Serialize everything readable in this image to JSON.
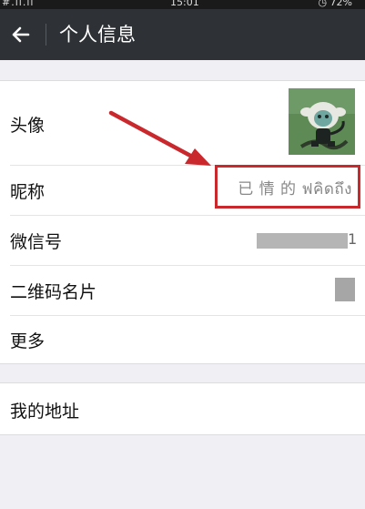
{
  "status_bar": {
    "signal": "#.ıl.ıl",
    "time": "15:01",
    "battery": "72%"
  },
  "header": {
    "title": "个人信息"
  },
  "profile": {
    "avatar_label": "头像",
    "nickname_label": "昵称",
    "nickname_value": "已 情 的 ฟคิดถึง",
    "wechat_id_label": "微信号",
    "wechat_id_suffix": "1",
    "qr_label": "二维码名片",
    "more_label": "更多"
  },
  "address": {
    "label": "我的地址"
  },
  "colors": {
    "accent_red": "#c9282d",
    "title_bar": "#2e3237",
    "background": "#efeff4"
  },
  "icons": {
    "back": "arrow-left-icon",
    "clock": "clock-icon"
  }
}
